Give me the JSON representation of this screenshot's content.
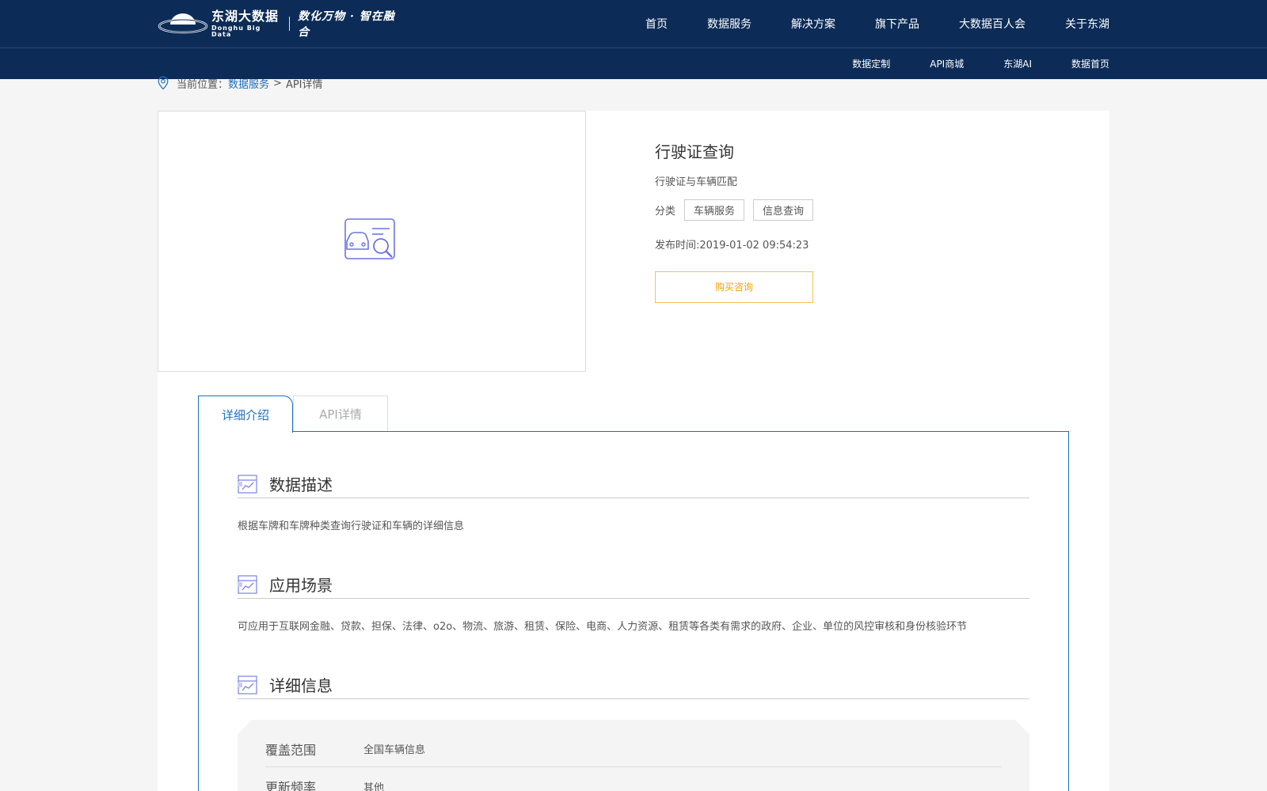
{
  "header": {
    "logo_cn": "东湖大数据",
    "logo_en": "Donghu Big Data",
    "slogan": "数化万物 · 智在融合",
    "nav": [
      "首页",
      "数据服务",
      "解决方案",
      "旗下产品",
      "大数据百人会",
      "关于东湖"
    ],
    "subnav": [
      "数据定制",
      "API商城",
      "东湖AI",
      "数据首页"
    ]
  },
  "breadcrumb": {
    "prefix": "当前位置：",
    "link": "数据服务",
    "separator": ">",
    "current": "API详情"
  },
  "product": {
    "title": "行驶证查询",
    "subtitle": "行驶证与车辆匹配",
    "category_label": "分类",
    "tags": [
      "车辆服务",
      "信息查询"
    ],
    "publish_time": "发布时间:2019-01-02 09:54:23",
    "buy_button": "购买咨询",
    "image_icon": "car-search-icon"
  },
  "tabs": [
    {
      "label": "详细介绍",
      "active": true
    },
    {
      "label": "API详情",
      "active": false
    }
  ],
  "sections": [
    {
      "title": "数据描述",
      "body": "根据车牌和车牌种类查询行驶证和车辆的详细信息"
    },
    {
      "title": "应用场景",
      "body": "可应用于互联网金融、贷款、担保、法律、o2o、物流、旅游、租赁、保险、电商、人力资源、租赁等各类有需求的政府、企业、单位的风控审核和身份核验环节"
    },
    {
      "title": "详细信息",
      "body": ""
    }
  ],
  "details": [
    {
      "label": "覆盖范围",
      "value": "全国车辆信息"
    },
    {
      "label": "更新频率",
      "value": "其他"
    }
  ],
  "colors": {
    "header_bg": "#0c2c57",
    "accent_blue": "#1d6fc0",
    "buy_orange": "#f3a300"
  }
}
